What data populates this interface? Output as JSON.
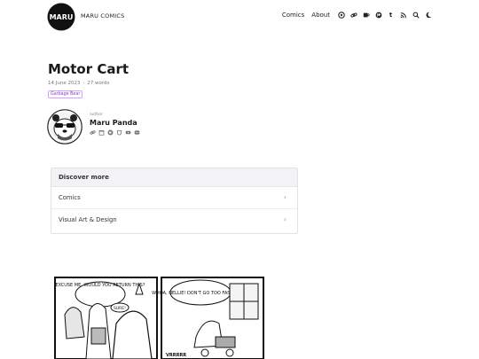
{
  "header": {
    "logo_text": "MARU",
    "site_name": "MARU COMICS",
    "nav": {
      "comics": "Comics",
      "about": "About"
    },
    "nav_icons": [
      "mastodon-icon",
      "link-icon",
      "kofi-icon",
      "patreon-icon",
      "tumblr-icon",
      "rss-icon",
      "search-icon",
      "dark-mode-icon"
    ]
  },
  "post": {
    "title": "Motor Cart",
    "date": "14 June 2023",
    "separator": "·",
    "words": "27 words",
    "tag": "Garbage Bear"
  },
  "author": {
    "label": "author",
    "name": "Maru Panda",
    "link_icons": [
      "link-icon",
      "shop-icon",
      "kofi-icon",
      "patreon-icon",
      "youtube-icon",
      "discord-icon"
    ]
  },
  "discover": {
    "title": "Discover more",
    "items": [
      {
        "label": "Comics",
        "chevron": "›"
      },
      {
        "label": "Visual Art & Design",
        "chevron": "›"
      }
    ]
  },
  "comic": {
    "panel1": {
      "bubble1": "EXCUSE ME, WOULD YOU RETURN THIS?",
      "bubble2": "SURE!"
    },
    "panel2": {
      "bubble": "WHOA, NELLIE! DON'T GO TOO FAST NOW...",
      "sfx": "VRRRRR"
    }
  }
}
